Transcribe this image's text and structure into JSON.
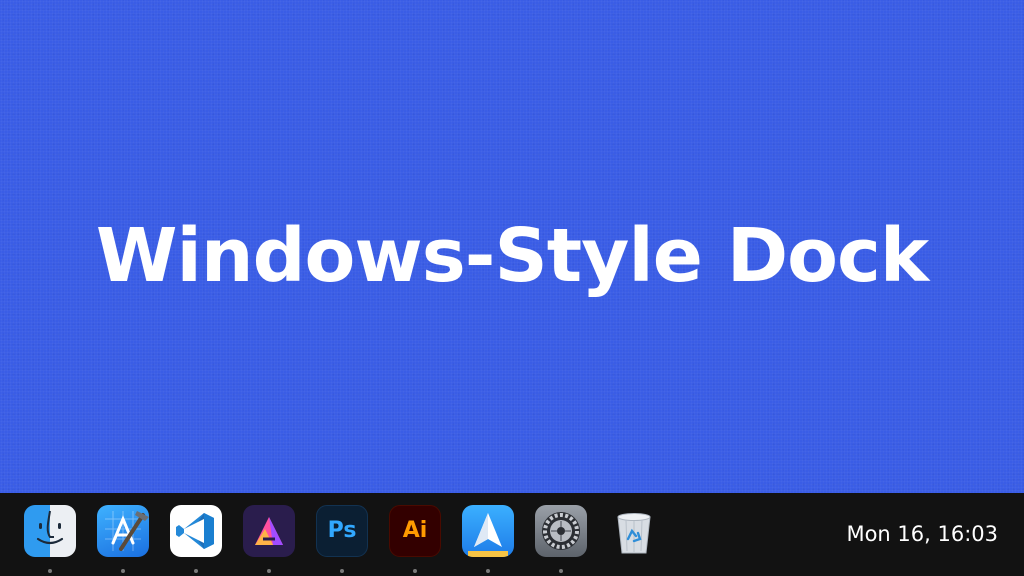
{
  "desktop": {
    "headline": "Windows-Style Dock",
    "background_color": "#3a5de6"
  },
  "dock": {
    "background_color": "#121212",
    "items": [
      {
        "app": "Finder",
        "icon": "finder-icon",
        "running": true
      },
      {
        "app": "Xcode",
        "icon": "xcode-icon",
        "running": true
      },
      {
        "app": "Visual Studio Code",
        "icon": "vscode-icon",
        "running": true
      },
      {
        "app": "Affinity",
        "icon": "affinity-icon",
        "running": true
      },
      {
        "app": "Photoshop",
        "icon": "photoshop-icon",
        "label": "Ps",
        "running": true
      },
      {
        "app": "Illustrator",
        "icon": "illustrator-icon",
        "label": "Ai",
        "running": true
      },
      {
        "app": "Spark",
        "icon": "spark-mail-icon",
        "running": true
      },
      {
        "app": "System Settings",
        "icon": "settings-gear-icon",
        "running": true
      },
      {
        "app": "Trash",
        "icon": "trash-recycle-icon",
        "running": false
      }
    ],
    "clock": "Mon 16, 16:03"
  }
}
